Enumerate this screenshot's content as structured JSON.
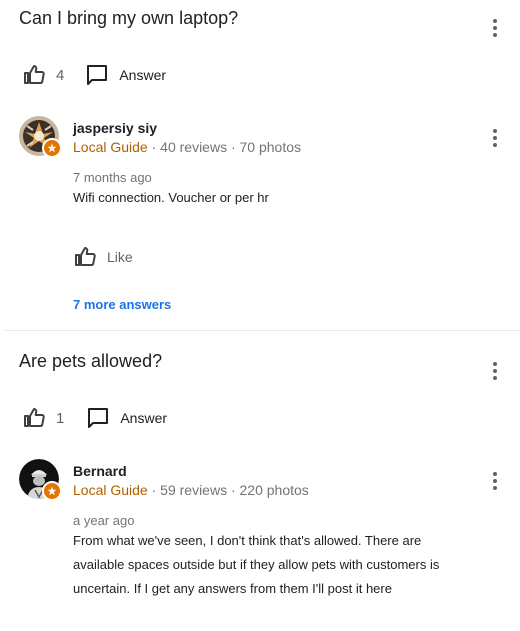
{
  "questions": [
    {
      "title": "Can I bring my own laptop?",
      "like_count": "4",
      "answer_label": "Answer",
      "answer": {
        "author": "jaspersiy siy",
        "guide_label": "Local Guide",
        "reviews": "· 40 reviews · 70 photos",
        "time": "7 months ago",
        "text": "Wifi connection. Voucher or per hr",
        "like_label": "Like"
      },
      "more_answers": "7 more answers"
    },
    {
      "title": "Are pets allowed?",
      "like_count": "1",
      "answer_label": "Answer",
      "answer": {
        "author": "Bernard",
        "guide_label": "Local Guide",
        "reviews": "· 59 reviews · 220 photos",
        "time": "a year ago",
        "text": "From what we've seen, I don't think that's allowed. There are available spaces outside but if they allow pets with customers is uncertain. If I get any answers from them I'll post it here"
      }
    }
  ],
  "icons": {
    "more": "more-vert-icon",
    "thumb": "thumb-up-outline-icon",
    "answer": "chat-bubble-outline-icon",
    "badge": "local-guide-star-icon"
  },
  "colors": {
    "link": "#1a73e8",
    "guide": "#b06000",
    "badge": "#e37400",
    "meta": "#70757a"
  }
}
